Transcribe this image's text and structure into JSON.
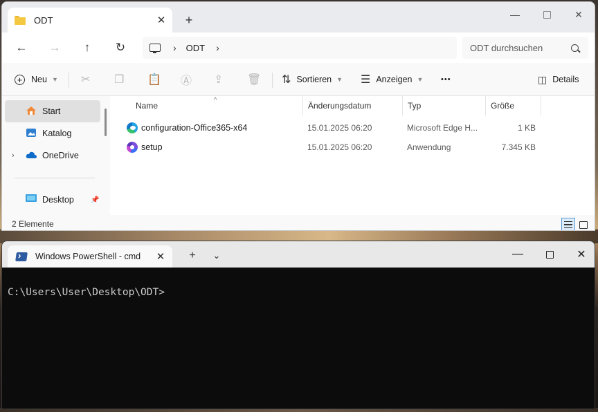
{
  "explorer": {
    "tab_title": "ODT",
    "tab_close": "✕",
    "new_tab": "+",
    "window_controls": {
      "minimize": "—",
      "close": "✕"
    },
    "nav": {
      "back": "←",
      "forward": "→",
      "up": "↑",
      "refresh": "↻"
    },
    "address": {
      "crumbs": [
        "ODT"
      ]
    },
    "search_placeholder": "ODT durchsuchen",
    "toolbar": {
      "new_label": "Neu",
      "sort_label": "Sortieren",
      "view_label": "Anzeigen",
      "more_label": "•••",
      "details_label": "Details"
    },
    "sidebar": {
      "items": [
        {
          "label": "Start",
          "active": true
        },
        {
          "label": "Katalog"
        },
        {
          "label": "OneDrive",
          "expandable": true
        },
        {
          "label": "Desktop",
          "pinned": true
        }
      ]
    },
    "columns": [
      "Name",
      "Änderungsdatum",
      "Typ",
      "Größe"
    ],
    "files": [
      {
        "name": "configuration-Office365-x64",
        "modified": "15.01.2025 06:20",
        "type": "Microsoft Edge H...",
        "size": "1 KB",
        "icon": "edge-icon"
      },
      {
        "name": "setup",
        "modified": "15.01.2025 06:20",
        "type": "Anwendung",
        "size": "7.345 KB",
        "icon": "setup-icon"
      }
    ],
    "status": "2 Elemente"
  },
  "terminal": {
    "tab_title": "Windows PowerShell - cmd",
    "tab_close": "✕",
    "new_tab": "+",
    "dropdown": "⌄",
    "window_controls": {
      "minimize": "—",
      "close": "✕"
    },
    "prompt": "C:\\Users\\User\\Desktop\\ODT>"
  },
  "colors": {
    "terminal_bg": "#0c0c0c",
    "terminal_fg": "#cccccc",
    "accent": "#5a9ad8"
  }
}
